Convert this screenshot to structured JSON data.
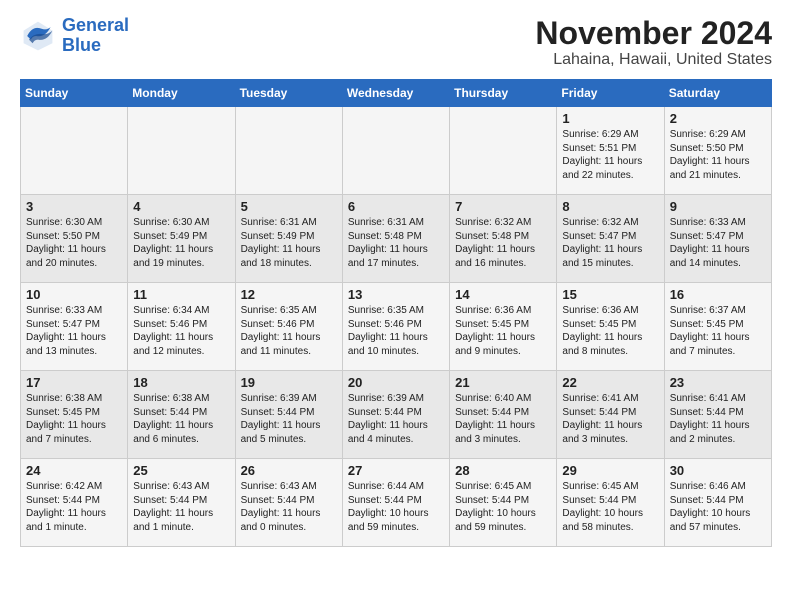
{
  "logo": {
    "line1": "General",
    "line2": "Blue"
  },
  "title": "November 2024",
  "subtitle": "Lahaina, Hawaii, United States",
  "days_of_week": [
    "Sunday",
    "Monday",
    "Tuesday",
    "Wednesday",
    "Thursday",
    "Friday",
    "Saturday"
  ],
  "weeks": [
    [
      {
        "day": "",
        "info": ""
      },
      {
        "day": "",
        "info": ""
      },
      {
        "day": "",
        "info": ""
      },
      {
        "day": "",
        "info": ""
      },
      {
        "day": "",
        "info": ""
      },
      {
        "day": "1",
        "info": "Sunrise: 6:29 AM\nSunset: 5:51 PM\nDaylight: 11 hours\nand 22 minutes."
      },
      {
        "day": "2",
        "info": "Sunrise: 6:29 AM\nSunset: 5:50 PM\nDaylight: 11 hours\nand 21 minutes."
      }
    ],
    [
      {
        "day": "3",
        "info": "Sunrise: 6:30 AM\nSunset: 5:50 PM\nDaylight: 11 hours\nand 20 minutes."
      },
      {
        "day": "4",
        "info": "Sunrise: 6:30 AM\nSunset: 5:49 PM\nDaylight: 11 hours\nand 19 minutes."
      },
      {
        "day": "5",
        "info": "Sunrise: 6:31 AM\nSunset: 5:49 PM\nDaylight: 11 hours\nand 18 minutes."
      },
      {
        "day": "6",
        "info": "Sunrise: 6:31 AM\nSunset: 5:48 PM\nDaylight: 11 hours\nand 17 minutes."
      },
      {
        "day": "7",
        "info": "Sunrise: 6:32 AM\nSunset: 5:48 PM\nDaylight: 11 hours\nand 16 minutes."
      },
      {
        "day": "8",
        "info": "Sunrise: 6:32 AM\nSunset: 5:47 PM\nDaylight: 11 hours\nand 15 minutes."
      },
      {
        "day": "9",
        "info": "Sunrise: 6:33 AM\nSunset: 5:47 PM\nDaylight: 11 hours\nand 14 minutes."
      }
    ],
    [
      {
        "day": "10",
        "info": "Sunrise: 6:33 AM\nSunset: 5:47 PM\nDaylight: 11 hours\nand 13 minutes."
      },
      {
        "day": "11",
        "info": "Sunrise: 6:34 AM\nSunset: 5:46 PM\nDaylight: 11 hours\nand 12 minutes."
      },
      {
        "day": "12",
        "info": "Sunrise: 6:35 AM\nSunset: 5:46 PM\nDaylight: 11 hours\nand 11 minutes."
      },
      {
        "day": "13",
        "info": "Sunrise: 6:35 AM\nSunset: 5:46 PM\nDaylight: 11 hours\nand 10 minutes."
      },
      {
        "day": "14",
        "info": "Sunrise: 6:36 AM\nSunset: 5:45 PM\nDaylight: 11 hours\nand 9 minutes."
      },
      {
        "day": "15",
        "info": "Sunrise: 6:36 AM\nSunset: 5:45 PM\nDaylight: 11 hours\nand 8 minutes."
      },
      {
        "day": "16",
        "info": "Sunrise: 6:37 AM\nSunset: 5:45 PM\nDaylight: 11 hours\nand 7 minutes."
      }
    ],
    [
      {
        "day": "17",
        "info": "Sunrise: 6:38 AM\nSunset: 5:45 PM\nDaylight: 11 hours\nand 7 minutes."
      },
      {
        "day": "18",
        "info": "Sunrise: 6:38 AM\nSunset: 5:44 PM\nDaylight: 11 hours\nand 6 minutes."
      },
      {
        "day": "19",
        "info": "Sunrise: 6:39 AM\nSunset: 5:44 PM\nDaylight: 11 hours\nand 5 minutes."
      },
      {
        "day": "20",
        "info": "Sunrise: 6:39 AM\nSunset: 5:44 PM\nDaylight: 11 hours\nand 4 minutes."
      },
      {
        "day": "21",
        "info": "Sunrise: 6:40 AM\nSunset: 5:44 PM\nDaylight: 11 hours\nand 3 minutes."
      },
      {
        "day": "22",
        "info": "Sunrise: 6:41 AM\nSunset: 5:44 PM\nDaylight: 11 hours\nand 3 minutes."
      },
      {
        "day": "23",
        "info": "Sunrise: 6:41 AM\nSunset: 5:44 PM\nDaylight: 11 hours\nand 2 minutes."
      }
    ],
    [
      {
        "day": "24",
        "info": "Sunrise: 6:42 AM\nSunset: 5:44 PM\nDaylight: 11 hours\nand 1 minute."
      },
      {
        "day": "25",
        "info": "Sunrise: 6:43 AM\nSunset: 5:44 PM\nDaylight: 11 hours\nand 1 minute."
      },
      {
        "day": "26",
        "info": "Sunrise: 6:43 AM\nSunset: 5:44 PM\nDaylight: 11 hours\nand 0 minutes."
      },
      {
        "day": "27",
        "info": "Sunrise: 6:44 AM\nSunset: 5:44 PM\nDaylight: 10 hours\nand 59 minutes."
      },
      {
        "day": "28",
        "info": "Sunrise: 6:45 AM\nSunset: 5:44 PM\nDaylight: 10 hours\nand 59 minutes."
      },
      {
        "day": "29",
        "info": "Sunrise: 6:45 AM\nSunset: 5:44 PM\nDaylight: 10 hours\nand 58 minutes."
      },
      {
        "day": "30",
        "info": "Sunrise: 6:46 AM\nSunset: 5:44 PM\nDaylight: 10 hours\nand 57 minutes."
      }
    ]
  ]
}
